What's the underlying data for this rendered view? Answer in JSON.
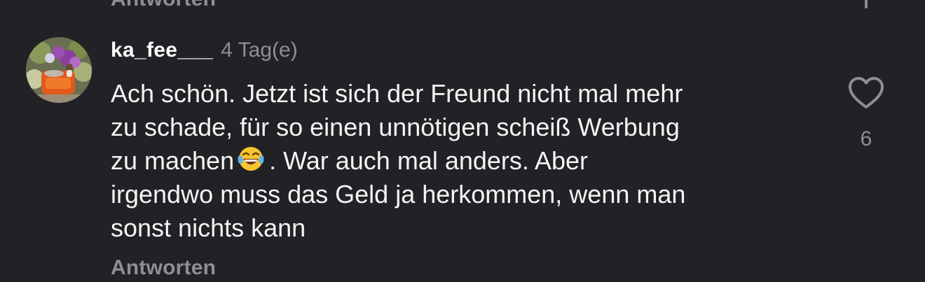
{
  "previous_comment": {
    "reply_label": "Antworten"
  },
  "comment": {
    "username": "ka_fee___",
    "timestamp": "4 Tag(e)",
    "text_lines": [
      "Ach schön. Jetzt ist sich der Freund nicht mal mehr",
      "zu schade, für so einen unnötigen scheiß Werbung",
      "zu machen",
      ". War auch mal anders. Aber",
      "irgendwo muss das Geld ja herkommen, wenn man",
      "sonst nichts kann"
    ],
    "emoji": "face-with-tears-of-joy",
    "like_count": "6",
    "reply_label": "Antworten",
    "like_icon": "heart-outline-icon"
  },
  "colors": {
    "background": "#222226",
    "text": "#f4f4f4",
    "secondary": "#8e8e93"
  }
}
